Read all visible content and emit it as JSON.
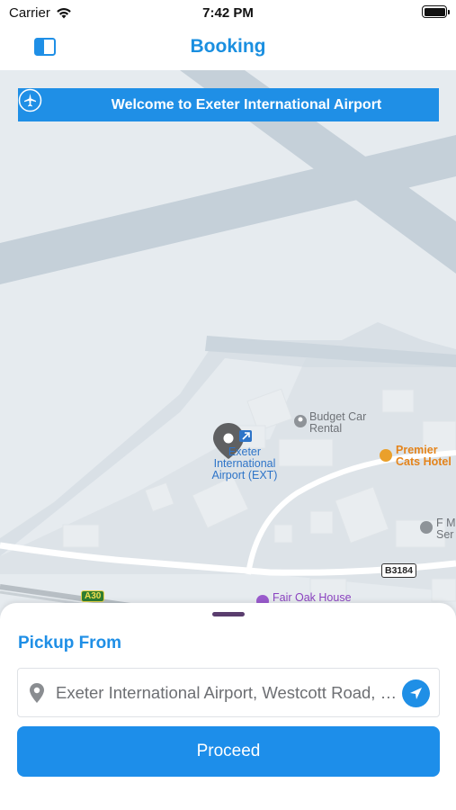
{
  "status_bar": {
    "carrier": "Carrier",
    "time": "7:42 PM",
    "battery_level": 1.0
  },
  "nav": {
    "title": "Booking",
    "sidebar_icon": "sidebar-toggle-icon"
  },
  "map": {
    "banner": {
      "text": "Welcome to Exeter International Airport",
      "icon": "airplane-icon"
    },
    "labels": {
      "airport": "Exeter\nInternational\nAirport (EXT)",
      "budget": "Budget Car\nRental",
      "premier": "Premier\nCats Hotel",
      "fm_partial": "F M\nSer",
      "fair_oak": "Fair Oak House",
      "road_b3184": "B3184",
      "road_a30": "A30"
    }
  },
  "sheet": {
    "pickup_label": "Pickup From",
    "pickup_value": "Exeter International Airport, Westcott Road, Exeter",
    "proceed_label": "Proceed"
  },
  "colors": {
    "accent": "#1f8fe6",
    "map_bg": "#e6ebef"
  }
}
